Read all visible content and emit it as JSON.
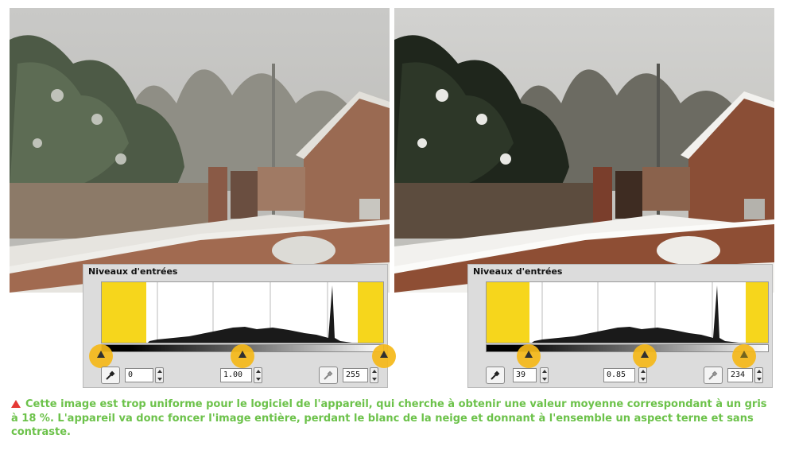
{
  "panels": [
    {
      "title": "Niveaux d'entrées",
      "black_input": "0",
      "gamma_input": "1.00",
      "white_input": "255",
      "marker_levels": [
        0,
        128,
        255
      ],
      "last_marker_hollow": false
    },
    {
      "title": "Niveaux d'entrées",
      "black_input": "39",
      "gamma_input": "0.85",
      "white_input": "234",
      "marker_levels": [
        39,
        128,
        234
      ],
      "last_marker_hollow": true
    }
  ],
  "caption": {
    "symbol": "triangle-icon",
    "text": "Cette image est trop uniforme pour le logiciel de l'appareil, qui cherche à obtenir une valeur moyenne correspondant à un gris à 18 %. L'appareil va donc foncer l'image entière, perdant le blanc de la neige et donnant à l'ensemble un aspect terne et sans contraste."
  },
  "colors": {
    "highlight_yellow": "#f6d61c",
    "marker_orange": "#f6b919",
    "caption_green": "#6cc24a",
    "caption_triangle_red": "#e53935"
  }
}
